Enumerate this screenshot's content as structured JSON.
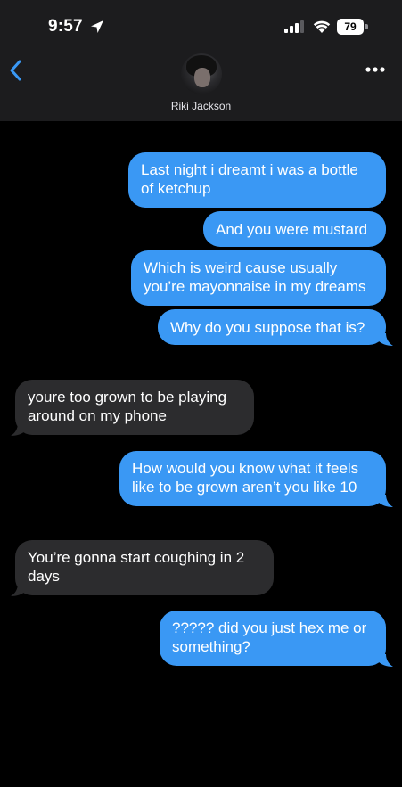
{
  "status_bar": {
    "time": "9:57",
    "battery": "79",
    "icons": [
      "location-arrow-icon",
      "cellular-signal-icon",
      "wifi-icon",
      "battery-icon"
    ]
  },
  "nav": {
    "contact_name": "Riki Jackson",
    "back_icon": "chevron-left-icon",
    "more_icon": "ellipsis-icon"
  },
  "colors": {
    "sent_bubble": "#3a98f4",
    "received_bubble": "#2c2c2e",
    "header_bg": "#1c1c1e",
    "accent": "#3a98f4",
    "background": "#000000"
  },
  "messages": [
    {
      "direction": "sent",
      "lines": [
        "Last night i dreamt i was a bottle",
        "of ketchup"
      ]
    },
    {
      "direction": "sent",
      "lines": [
        "And you were mustard"
      ]
    },
    {
      "direction": "sent",
      "lines": [
        "Which is weird cause usually",
        "you’re mayonnaise in my dreams"
      ]
    },
    {
      "direction": "sent",
      "lines": [
        "Why do you suppose that is?"
      ]
    },
    {
      "direction": "received",
      "lines": [
        "youre too grown to be playing",
        "around on my phone"
      ]
    },
    {
      "direction": "sent",
      "lines": [
        "How would you know what it feels",
        "like to be grown aren’t you like 10"
      ]
    },
    {
      "direction": "received",
      "lines": [
        "You’re gonna start coughing in 2",
        "days"
      ]
    },
    {
      "direction": "sent",
      "lines": [
        "????? did you just hex me or",
        "something?"
      ]
    }
  ]
}
